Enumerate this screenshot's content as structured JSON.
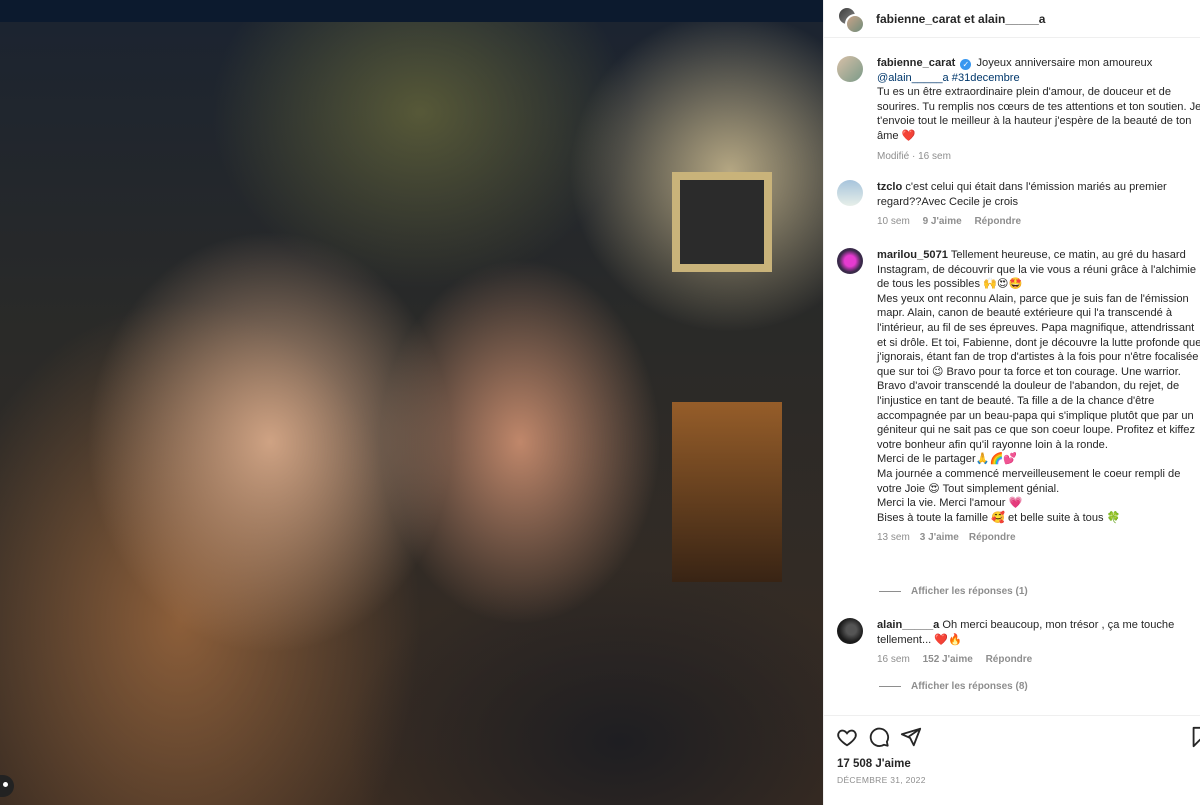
{
  "header": {
    "title": "fabienne_carat et alain_____a"
  },
  "caption": {
    "user": "fabienne_carat",
    "verified_glyph": "✓",
    "text_1": "Joyeux anniversaire mon amoureux",
    "mention": "@alain_____a #31decembre",
    "text_2": "Tu es un être extraordinaire plein d'amour, de douceur et de sourires. Tu remplis nos cœurs de tes attentions et ton soutien. Je t'envoie tout le meilleur à la hauteur j'espère de la beauté de ton âme ❤️",
    "meta_modified": "Modifié · 16 sem"
  },
  "comments": [
    {
      "user": "tzclo",
      "text": "c'est celui qui était dans l'émission mariés au premier regard??Avec Cecile je crois",
      "time": "10 sem",
      "likes": "9 J'aime",
      "reply": "Répondre"
    },
    {
      "user": "marilou_5071",
      "text": "Tellement heureuse, ce matin, au gré du hasard Instagram, de découvrir que la vie vous a réuni grâce à l'alchimie de tous les possibles 🙌😍🤩\nMes yeux ont reconnu Alain, parce que je suis fan de l'émission mapr. Alain, canon de beauté extérieure qui l'a transcendé à l'intérieur, au fil de ses épreuves. Papa magnifique, attendrissant et si drôle. Et toi, Fabienne, dont je découvre la lutte profonde que j'ignorais, étant fan de trop d'artistes à la fois pour n'être focalisée que sur toi 😉 Bravo pour ta force et ton courage. Une warrior. Bravo d'avoir transcendé la douleur de l'abandon, du rejet, de l'injustice en tant de beauté. Ta fille a de la chance d'être accompagnée par un beau-papa qui s'implique plutôt que par un géniteur qui ne sait pas ce que son coeur loupe. Profitez et kiffez votre bonheur afin qu'il rayonne loin à la ronde.\nMerci de le partager🙏🌈💕\nMa journée a commencé merveilleusement le coeur rempli de votre Joie 😍 Tout simplement génial.\nMerci la vie. Merci l'amour 💗\nBises à toute la famille 🥰 et belle suite à tous 🍀",
      "time": "13 sem",
      "likes": "3 J'aime",
      "reply": "Répondre",
      "view_replies": "Afficher les réponses (1)"
    },
    {
      "user": "alain_____a",
      "text": "Oh merci beaucoup, mon trésor , ça me touche tellement... ❤️🔥",
      "time": "16 sem",
      "likes": "152 J'aime",
      "reply": "Répondre",
      "view_replies": "Afficher les réponses (8)"
    }
  ],
  "actions": {
    "icons": [
      "heart-icon",
      "comment-icon",
      "share-icon",
      "bookmark-icon"
    ]
  },
  "likes_count": "17 508 J'aime",
  "post_date": "DÉCEMBRE 31, 2022",
  "colors": {
    "link": "#00376b",
    "verified": "#3897f0",
    "muted": "#8e8e8e"
  }
}
